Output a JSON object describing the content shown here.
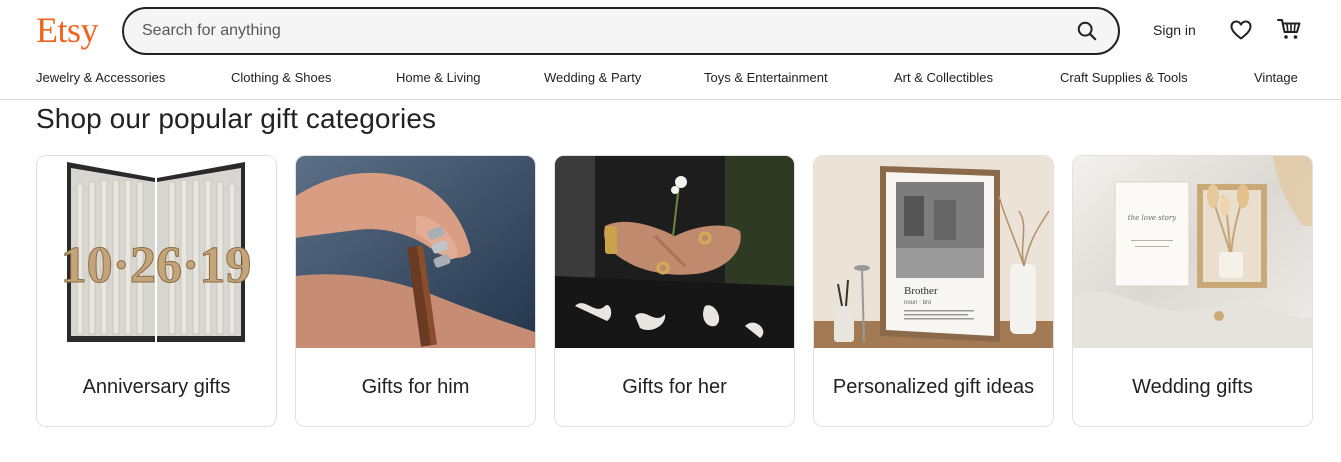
{
  "logo": "Etsy",
  "search": {
    "placeholder": "Search for anything"
  },
  "header": {
    "signin_label": "Sign in"
  },
  "nav": {
    "categories": [
      "Jewelry & Accessories",
      "Clothing & Shoes",
      "Home & Living",
      "Wedding & Party",
      "Toys & Entertainment",
      "Art & Collectibles",
      "Craft Supplies & Tools",
      "Vintage"
    ]
  },
  "section": {
    "title": "Shop our popular gift categories",
    "cards": [
      {
        "label": "Anniversary gifts",
        "image": "folded-book-art-10-26-19"
      },
      {
        "label": "Gifts for him",
        "image": "leather-bracelet-on-wrist"
      },
      {
        "label": "Gifts for her",
        "image": "hands-with-gold-rings-and-flower"
      },
      {
        "label": "Personalized gift ideas",
        "image": "framed-brother-photo-print"
      },
      {
        "label": "Wedding gifts",
        "image": "wedding-card-and-dried-flowers-box"
      }
    ],
    "artwork_text": {
      "book_date": "10·26·19",
      "print_title": "Brother",
      "print_subtitle": "noun · bro",
      "card_script": "the love story"
    }
  },
  "icons": {
    "search": "search-icon",
    "favorites": "heart-icon",
    "cart": "cart-icon"
  },
  "colors": {
    "brand": "#f1641e",
    "text": "#222222",
    "search_bg": "#f5f5f5"
  }
}
